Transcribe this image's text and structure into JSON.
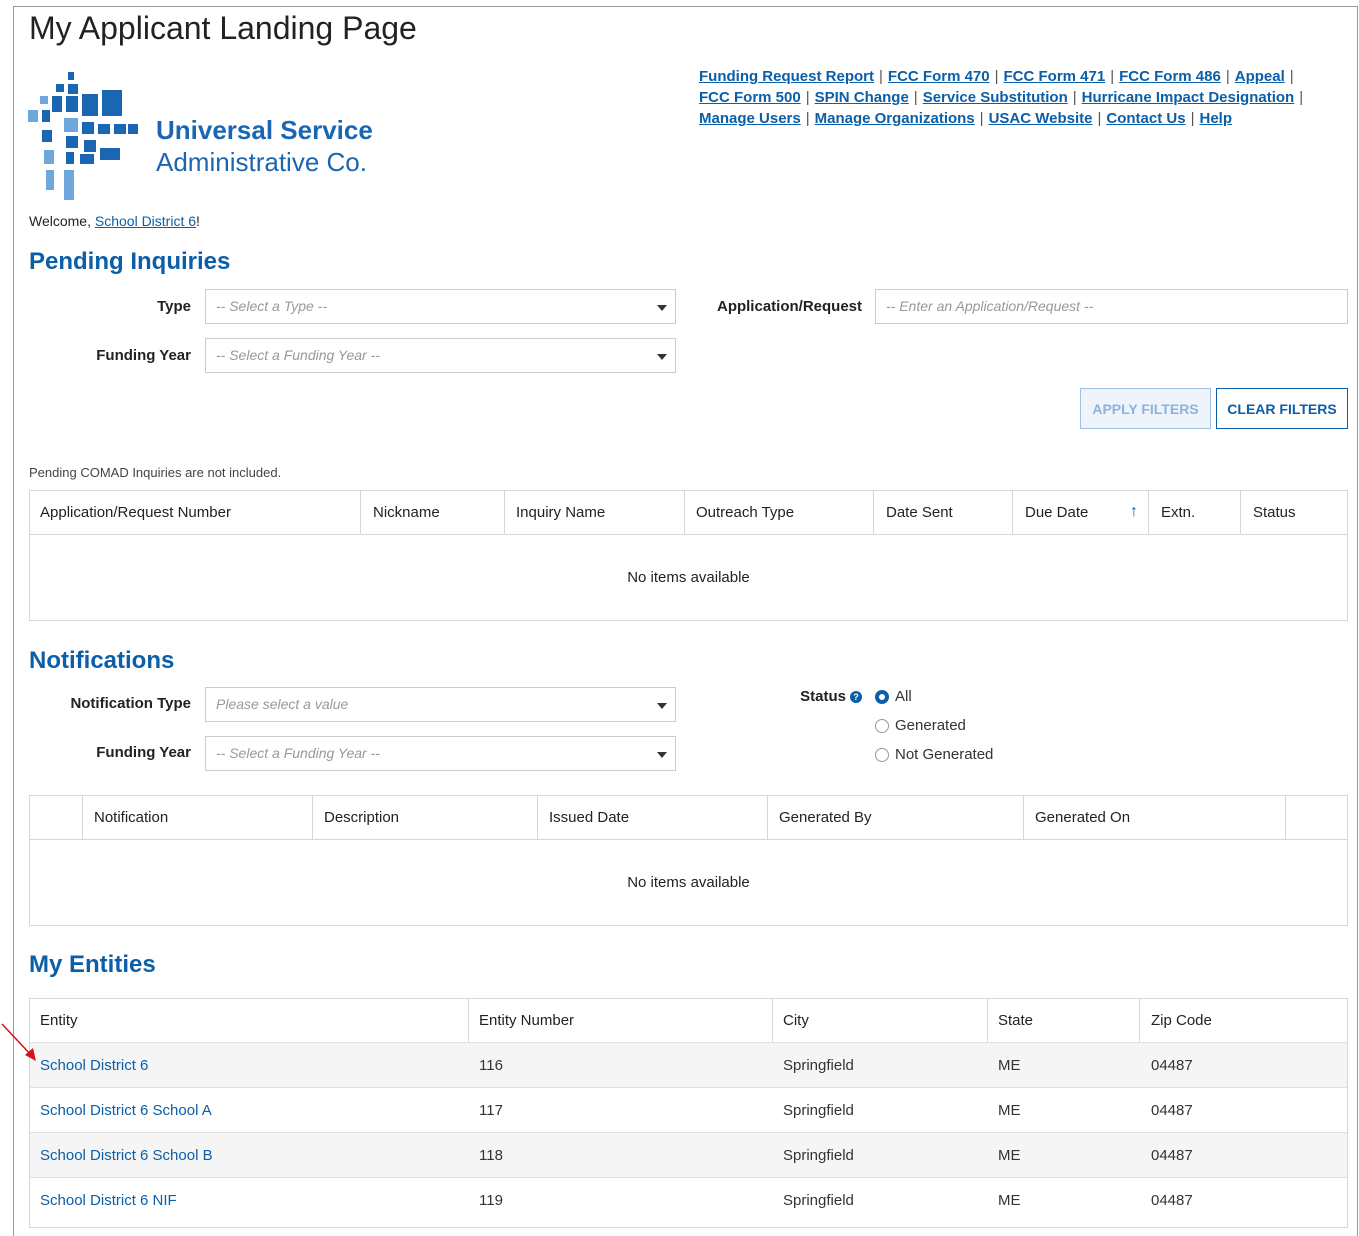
{
  "page": {
    "title": "My Applicant Landing Page"
  },
  "logo": {
    "line1": "Universal Service",
    "line2": "Administrative Co."
  },
  "top_links": [
    "Funding Request Report",
    "FCC Form 470",
    "FCC Form 471",
    "FCC Form 486",
    "Appeal",
    "FCC Form 500",
    "SPIN Change",
    "Service Substitution",
    "Hurricane Impact Designation",
    "Manage Users",
    "Manage Organizations",
    "USAC Website",
    "Contact Us",
    "Help"
  ],
  "welcome": {
    "prefix": "Welcome, ",
    "user": "School District 6",
    "suffix": "!"
  },
  "pending": {
    "heading": "Pending Inquiries",
    "type_label": "Type",
    "type_placeholder": "-- Select a Type --",
    "app_label": "Application/Request",
    "app_placeholder": "-- Enter an Application/Request --",
    "fy_label": "Funding Year",
    "fy_placeholder": "-- Select a Funding Year --",
    "apply_label": "APPLY FILTERS",
    "clear_label": "CLEAR FILTERS",
    "note": "Pending COMAD Inquiries are not included.",
    "columns": [
      "Application/Request Number",
      "Nickname",
      "Inquiry Name",
      "Outreach Type",
      "Date Sent",
      "Due Date",
      "Extn.",
      "Status"
    ],
    "empty": "No items available"
  },
  "notifications": {
    "heading": "Notifications",
    "type_label": "Notification Type",
    "type_placeholder": "Please select a value",
    "fy_label": "Funding Year",
    "fy_placeholder": "-- Select a Funding Year --",
    "status_label": "Status",
    "status_options": [
      "All",
      "Generated",
      "Not Generated"
    ],
    "status_selected": "All",
    "columns": [
      "Notification",
      "Description",
      "Issued Date",
      "Generated By",
      "Generated On"
    ],
    "empty": "No items available"
  },
  "entities": {
    "heading": "My Entities",
    "columns": [
      "Entity",
      "Entity Number",
      "City",
      "State",
      "Zip Code"
    ],
    "rows": [
      {
        "entity": "School District 6",
        "number": "116",
        "city": "Springfield",
        "state": "ME",
        "zip": "04487"
      },
      {
        "entity": "School District 6 School A",
        "number": "117",
        "city": "Springfield",
        "state": "ME",
        "zip": "04487"
      },
      {
        "entity": "School District 6 School B",
        "number": "118",
        "city": "Springfield",
        "state": "ME",
        "zip": "04487"
      },
      {
        "entity": "School District 6 NIF",
        "number": "119",
        "city": "Springfield",
        "state": "ME",
        "zip": "04487"
      }
    ]
  },
  "colors": {
    "link": "#0b5ea8",
    "arrow": "#d0141b"
  }
}
